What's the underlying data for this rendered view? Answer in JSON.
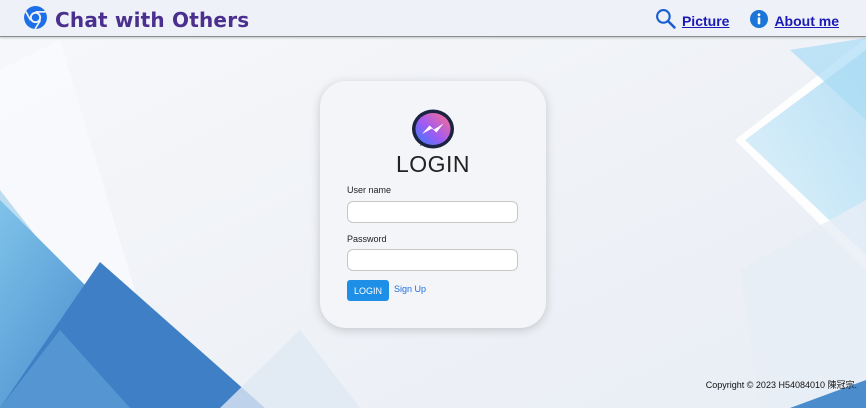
{
  "header": {
    "brand_icon": "chrome-icon",
    "title": "Chat with Others",
    "nav": [
      {
        "label": "Picture",
        "icon": "search-icon"
      },
      {
        "label": "About me",
        "icon": "info-icon"
      }
    ]
  },
  "login_card": {
    "logo": "messenger-icon",
    "title": "LOGIN",
    "username_label": "User name",
    "username_value": "",
    "password_label": "Password",
    "password_value": "",
    "login_button": "LOGIN",
    "signup_link": "Sign Up"
  },
  "footer": {
    "copyright": "Copyright © 2023 H54084010 陳冠宗."
  },
  "colors": {
    "brand_title": "#4a2f8f",
    "nav_link": "#1a1ab5",
    "login_button": "#1e8fe6",
    "signup_link": "#1f6fe0",
    "background_blue": "#4b8dcc"
  }
}
